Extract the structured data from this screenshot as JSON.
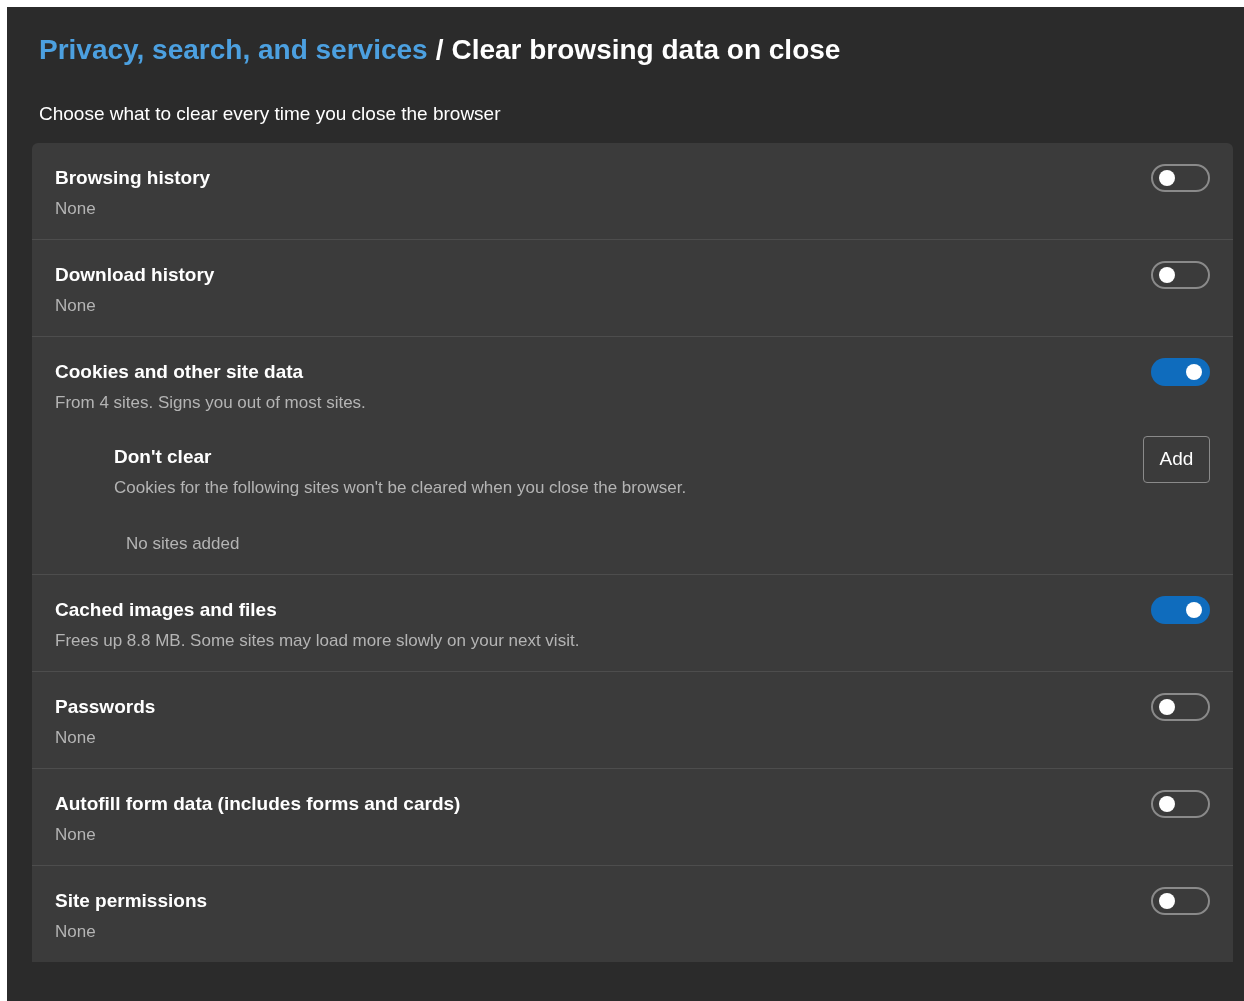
{
  "breadcrumb": {
    "parent": "Privacy, search, and services",
    "separator": "/",
    "current": "Clear browsing data on close"
  },
  "intro": "Choose what to clear every time you close the browser",
  "items": [
    {
      "title": "Browsing history",
      "detail": "None",
      "on": false
    },
    {
      "title": "Download history",
      "detail": "None",
      "on": false
    },
    {
      "title": "Cookies and other site data",
      "detail": "From 4 sites. Signs you out of most sites.",
      "on": true,
      "exceptions": {
        "title": "Don't clear",
        "description": "Cookies for the following sites won't be cleared when you close the browser.",
        "button": "Add",
        "empty": "No sites added"
      }
    },
    {
      "title": "Cached images and files",
      "detail": "Frees up 8.8 MB. Some sites may load more slowly on your next visit.",
      "on": true
    },
    {
      "title": "Passwords",
      "detail": "None",
      "on": false
    },
    {
      "title": "Autofill form data (includes forms and cards)",
      "detail": "None",
      "on": false
    },
    {
      "title": "Site permissions",
      "detail": "None",
      "on": false
    }
  ]
}
